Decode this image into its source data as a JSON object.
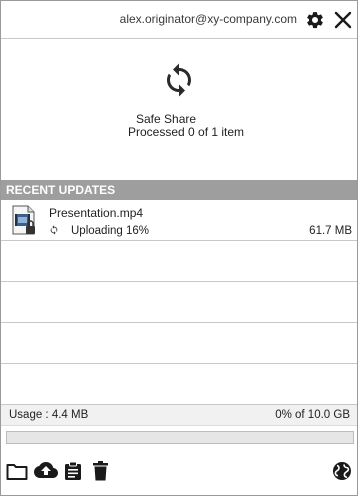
{
  "header": {
    "account_email": "alex.originator@xy-company.com",
    "icons": {
      "settings": "gear-icon",
      "close": "close-icon"
    }
  },
  "status": {
    "app_name": "Safe Share",
    "progress_text": "Processed 0 of 1 item",
    "icon": "sync-icon"
  },
  "recent_updates": {
    "title": "RECENT UPDATES",
    "items": [
      {
        "name": "Presentation.mp4",
        "status": "Uploading 16%",
        "size": "61.7 MB",
        "icon": "video-file-icon",
        "status_icon": "sync-icon"
      }
    ]
  },
  "usage": {
    "label": "Usage : 4.4 MB",
    "percent_text": "0% of 10.0 GB",
    "progress_fraction": 0.0
  },
  "toolbar": {
    "icons": [
      "folder-icon",
      "cloud-upload-icon",
      "clipboard-icon",
      "trash-icon",
      "globe-icon"
    ]
  },
  "colors": {
    "section_header_bg": "#9e9e9e",
    "icon_dark": "#1a1a1a",
    "usage_fill": "#4caf50"
  }
}
